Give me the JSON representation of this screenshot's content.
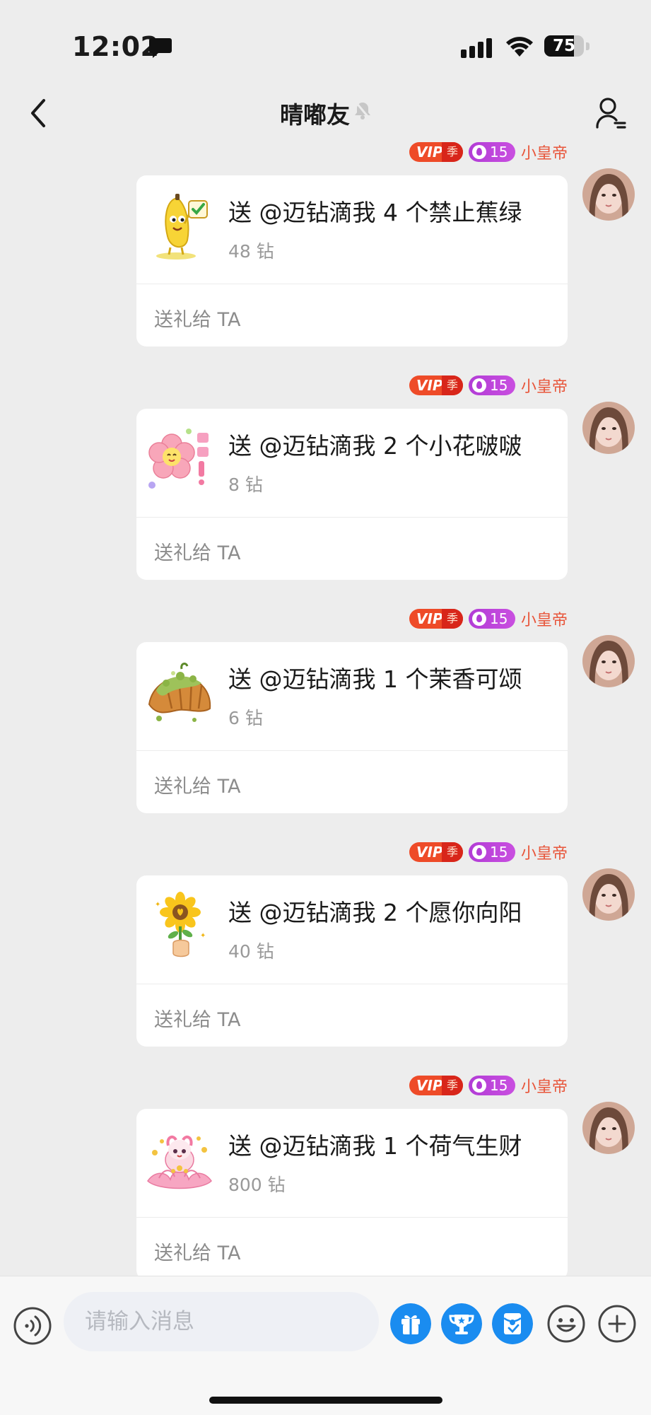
{
  "status_bar": {
    "time": "12:02",
    "battery": "75",
    "battery_level": 0.75
  },
  "nav": {
    "title": "晴嘟友",
    "back_icon": "chevron-left-icon",
    "mute_icon": "bell-mute-icon",
    "profile_icon": "user-settings-icon"
  },
  "sender": {
    "vip_label": "VIP",
    "vip_season": "季",
    "level": "15",
    "nickname": "小皇帝"
  },
  "messages": [
    {
      "title": "送 @迈钻滴我 4 个禁止蕉绿",
      "price": "48 钻",
      "action": "送礼给 TA",
      "gift_icon": "banana-gift-icon"
    },
    {
      "title": "送 @迈钻滴我 2 个小花啵啵",
      "price": "8 钻",
      "action": "送礼给 TA",
      "gift_icon": "flower-gift-icon"
    },
    {
      "title": "送 @迈钻滴我 1 个茉香可颂",
      "price": "6 钻",
      "action": "送礼给 TA",
      "gift_icon": "croissant-gift-icon"
    },
    {
      "title": "送 @迈钻滴我 2 个愿你向阳",
      "price": "40 钻",
      "action": "送礼给 TA",
      "gift_icon": "sunflower-gift-icon"
    },
    {
      "title": "送 @迈钻滴我 1 个荷气生财",
      "price": "800 钻",
      "action": "送礼给 TA",
      "gift_icon": "lotus-gift-icon"
    }
  ],
  "input": {
    "placeholder": "请输入消息",
    "value": ""
  },
  "toolbar": {
    "buttons": [
      "voice-icon",
      "gift-icon",
      "trophy-icon",
      "red-packet-icon",
      "emoji-icon",
      "plus-icon"
    ]
  },
  "colors": {
    "accent_blue": "#1a8cf0",
    "vip_red": "#ee4b28",
    "level_purple": "#b23cd6",
    "nickname": "#e8553a"
  }
}
